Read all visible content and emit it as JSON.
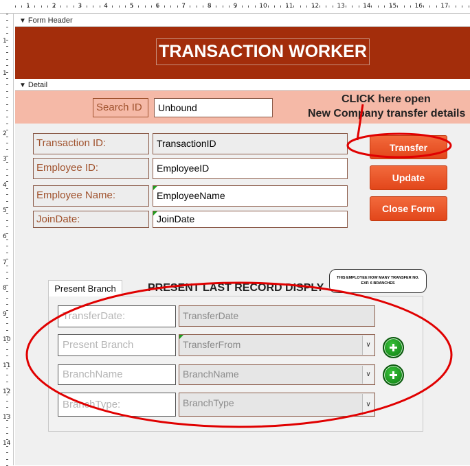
{
  "form_header": {
    "section_label": "Form Header",
    "title": "TRANSACTION WORKER"
  },
  "detail": {
    "section_label": "Detail"
  },
  "search": {
    "label": "Search ID",
    "value": "Unbound"
  },
  "fields": [
    {
      "label": "Transaction ID:",
      "value": "TransactionID"
    },
    {
      "label": "Employee ID:",
      "value": "EmployeeID"
    },
    {
      "label": "Employee Name:",
      "value": "EmployeeName"
    },
    {
      "label": "JoinDate:",
      "value": "JoinDate"
    }
  ],
  "buttons": {
    "transfer": "Transfer",
    "update": "Update",
    "close_form": "Close Form"
  },
  "annotation": {
    "line1": "CLICK here open",
    "line2": "New Company transfer details"
  },
  "present_branch": {
    "tab_label": "Present Branch",
    "heading": "PRESENT LAST RECORD DISPLY",
    "note_line1": "THIS EMPLOYEE HOW MANY TRANSFER NO.",
    "note_line2": "EXP. 6 BRANCHES",
    "rows": [
      {
        "label": "TransferDate:",
        "value": "TransferDate"
      },
      {
        "label": "Present Branch",
        "value": "TransferFrom"
      },
      {
        "label": "BranchName",
        "value": "BranchName"
      },
      {
        "label": "BranchType:",
        "value": "BranchType"
      }
    ]
  },
  "ruler": {
    "horizontal": [
      "1",
      "2",
      "3",
      "4",
      "5",
      "6",
      "7",
      "8",
      "9",
      "10",
      "11",
      "12",
      "13",
      "14",
      "15",
      "16",
      "17"
    ],
    "vertical": [
      "1",
      "1",
      "2",
      "3",
      "4",
      "5",
      "6",
      "7",
      "8",
      "9",
      "10",
      "11",
      "12",
      "13",
      "14"
    ]
  },
  "colors": {
    "header_band": "#a32d0b",
    "search_band": "#f5b9a7",
    "button": "#e2461b",
    "annotation_circle": "#e00000"
  }
}
